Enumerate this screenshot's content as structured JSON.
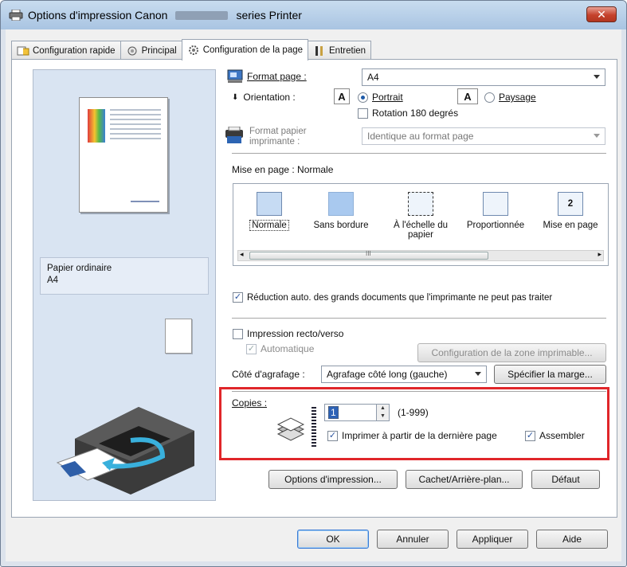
{
  "window": {
    "title_prefix": "Options d'impression Canon",
    "title_suffix": "series Printer",
    "close_label": "✕"
  },
  "tabs": [
    {
      "label": "Configuration rapide"
    },
    {
      "label": "Principal"
    },
    {
      "label": "Configuration de la page"
    },
    {
      "label": "Entretien"
    }
  ],
  "preview": {
    "paper_type": "Papier ordinaire",
    "paper_size": "A4"
  },
  "page_setup": {
    "format_label": "Format page :",
    "format_value": "A4",
    "orientation_label": "Orientation :",
    "orientation_icon_letter": "A",
    "portrait_label": "Portrait",
    "landscape_label": "Paysage",
    "rotation_label": "Rotation 180 degrés",
    "printer_paper_label_1": "Format papier",
    "printer_paper_label_2": "imprimante :",
    "printer_paper_value": "Identique au format page",
    "layout_label": "Mise en page : Normale",
    "layout_items": [
      {
        "label": "Normale"
      },
      {
        "label": "Sans bordure"
      },
      {
        "label": "À l'échelle du papier"
      },
      {
        "label": "Proportionnée"
      },
      {
        "label": "Mise en page"
      }
    ],
    "layout_item_5_num": "2",
    "scroll_mark": "III",
    "reduce_label": "Réduction auto. des grands documents que l'imprimante ne peut pas traiter",
    "duplex_label": "Impression recto/verso",
    "automatic_label": "Automatique",
    "print_area_btn": "Configuration de la zone imprimable...",
    "stapling_label": "Côté d'agrafage :",
    "stapling_value": "Agrafage côté long (gauche)",
    "margin_btn": "Spécifier la marge...",
    "copies_label": "Copies :",
    "copies_value": "1",
    "copies_range": "(1-999)",
    "last_page_label": "Imprimer à partir de la dernière page",
    "collate_label": "Assembler",
    "print_options_btn": "Options d'impression...",
    "stamp_btn": "Cachet/Arrière-plan...",
    "default_btn": "Défaut"
  },
  "footer": {
    "ok": "OK",
    "cancel": "Annuler",
    "apply": "Appliquer",
    "help": "Aide"
  },
  "colors": {
    "highlight_border": "#e0262a",
    "titlebar": "#b8d0ea",
    "close_button": "#c5422c"
  },
  "icons": [
    "printer-icon",
    "quick-setup-icon",
    "main-icon",
    "page-setup-icon",
    "maintenance-icon",
    "page-format-icon",
    "printer-paper-icon",
    "copies-stack-icon"
  ]
}
